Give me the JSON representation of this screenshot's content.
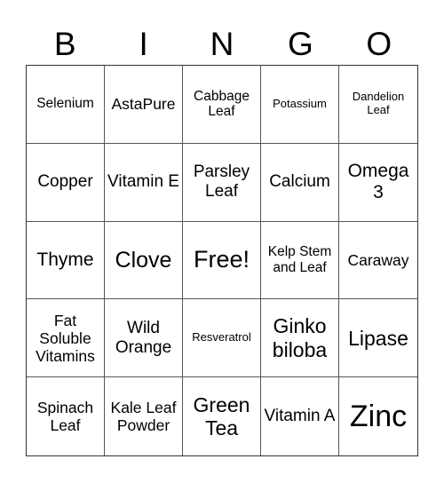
{
  "header": [
    "B",
    "I",
    "N",
    "G",
    "O"
  ],
  "cells": [
    "Selenium",
    "AstaPure",
    "Cabbage Leaf",
    "Potassium",
    "Dandelion Leaf",
    "Copper",
    "Vitamin E",
    "Parsley Leaf",
    "Calcium",
    "Omega 3",
    "Thyme",
    "Clove",
    "Free!",
    "Kelp Stem and Leaf",
    "Caraway",
    "Fat Soluble Vitamins",
    "Wild Orange",
    "Resveratrol",
    "Ginko biloba",
    "Lipase",
    "Spinach Leaf",
    "Kale Leaf Powder",
    "Green Tea",
    "Vitamin A",
    "Zinc"
  ]
}
